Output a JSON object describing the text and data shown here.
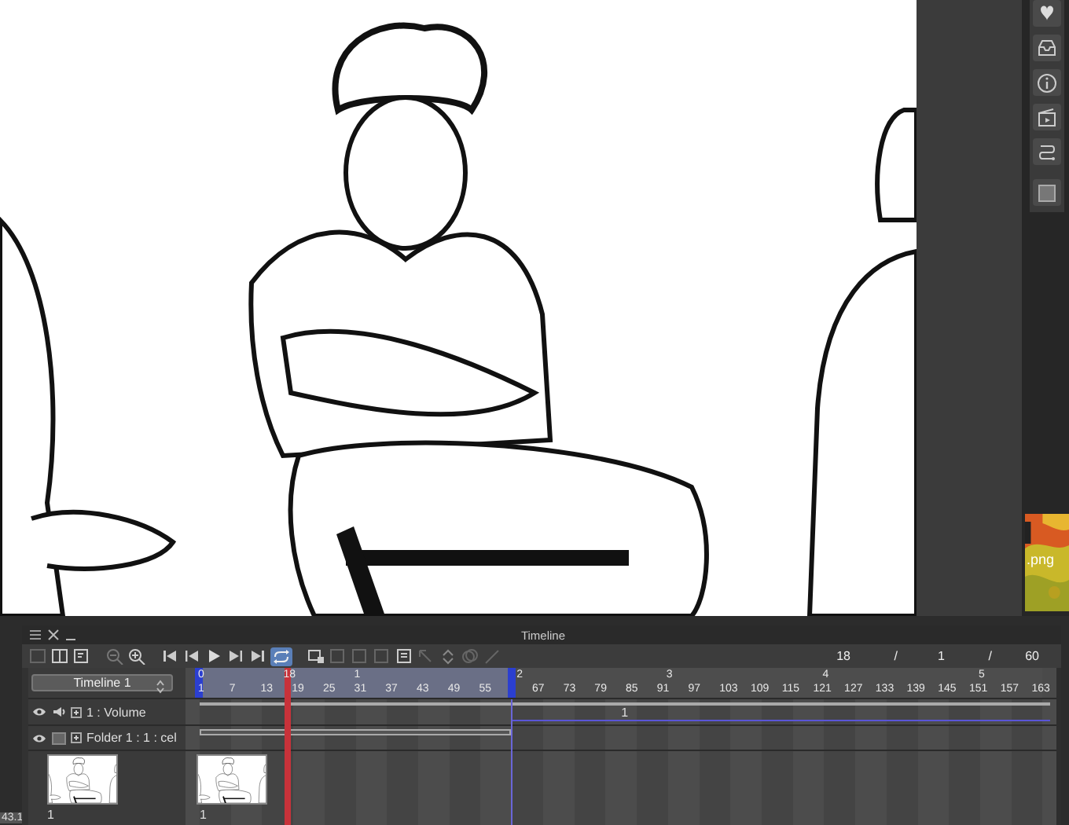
{
  "side_thumbnail": {
    "kind": "picture",
    "label": ".png"
  },
  "zoom_readout": "43.1",
  "timeline": {
    "title": "Timeline",
    "name": "Timeline 1",
    "loop_on": true,
    "frame_counter": [
      "18",
      "/",
      "1",
      "/",
      "60"
    ],
    "second_marks": [
      "0",
      "1",
      "2",
      "3",
      "4",
      "5"
    ],
    "frame_numbers": [
      "1",
      "7",
      "13",
      "19",
      "25",
      "31",
      "37",
      "43",
      "49",
      "55"
    ],
    "frame_numbers_after_work_area": [
      "67",
      "73",
      "79",
      "85",
      "91",
      "97",
      "103",
      "109",
      "115",
      "121",
      "127",
      "133",
      "139",
      "145",
      "151",
      "157",
      "163"
    ],
    "playhead": {
      "label": "18",
      "level": 0.105
    },
    "work_area": {
      "level": 0.37
    },
    "layers": [
      {
        "kind": "audio",
        "name": "1 : Volume",
        "visible": true,
        "track_label": "1"
      },
      {
        "kind": "folder",
        "name": "Folder 1 : 1 : cel",
        "visible": true
      }
    ],
    "layer_thumbnail": {
      "kind": "picture",
      "label": "1"
    },
    "track_cel": {
      "kind": "picture",
      "label": "1"
    }
  }
}
